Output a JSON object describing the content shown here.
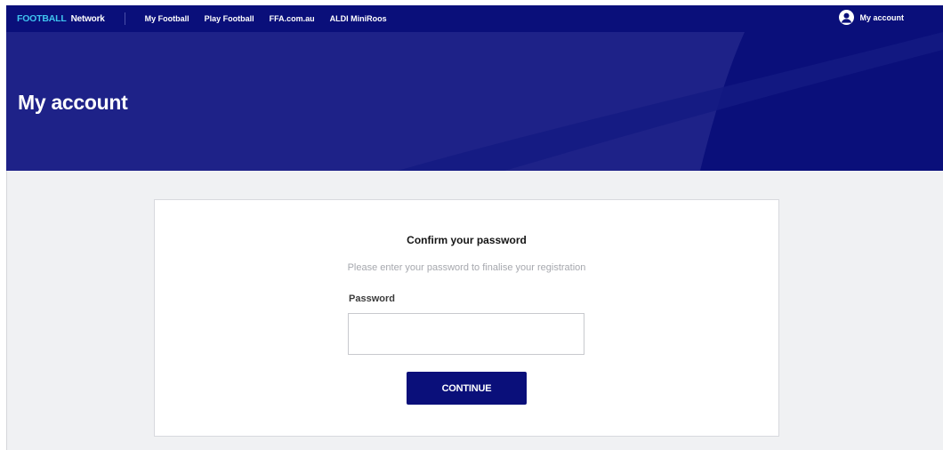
{
  "colors": {
    "navy": "#0a0f7a",
    "navy_light": "#1e2288",
    "brand_accent": "#3fc4f0",
    "page_bg": "#f0f1f3",
    "subtitle_gray": "#a6a8ae"
  },
  "topnav": {
    "brand_main": "FOOTBALL",
    "brand_sub": "Network",
    "links": [
      {
        "label": "My Football"
      },
      {
        "label": "Play Football"
      },
      {
        "label": "FFA.com.au"
      },
      {
        "label": "ALDI MiniRoos"
      }
    ],
    "account": {
      "icon": "user-circle-icon",
      "label": "My account"
    }
  },
  "hero": {
    "title": "My account"
  },
  "card": {
    "title": "Confirm your password",
    "subtitle": "Please enter your password to finalise your registration",
    "password_label": "Password",
    "password_value": "",
    "continue_label": "CONTINUE"
  }
}
